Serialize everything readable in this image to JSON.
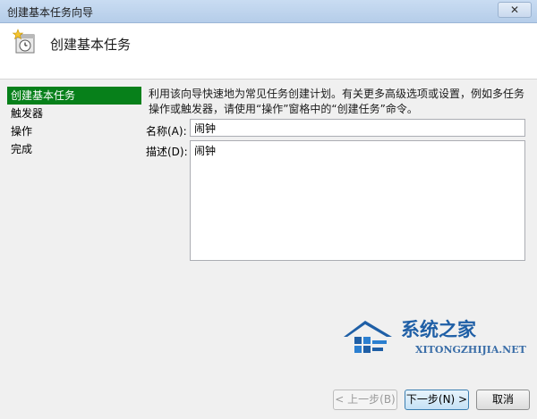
{
  "window": {
    "title": "创建基本任务向导",
    "close_label": "✕"
  },
  "header": {
    "title": "创建基本任务"
  },
  "sidebar": {
    "items": [
      {
        "label": "创建基本任务"
      },
      {
        "label": "触发器"
      },
      {
        "label": "操作"
      },
      {
        "label": "完成"
      }
    ]
  },
  "main": {
    "intro": "利用该向导快速地为常见任务创建计划。有关更多高级选项或设置，例如多任务操作或触发器，请使用“操作”窗格中的“创建任务”命令。",
    "name_label": "名称(A):",
    "name_value": "闹钟",
    "desc_label": "描述(D):",
    "desc_value": "闹钟"
  },
  "watermark": {
    "brand": "系统之家",
    "url": "XITONGZHIJIA.NET"
  },
  "buttons": {
    "prev": "< 上一步(B)",
    "next": "下一步(N) >",
    "cancel": "取消"
  },
  "colors": {
    "accent": "#07801a",
    "title_bar": "#c9dcf2",
    "brand": "#1f5fa6"
  }
}
